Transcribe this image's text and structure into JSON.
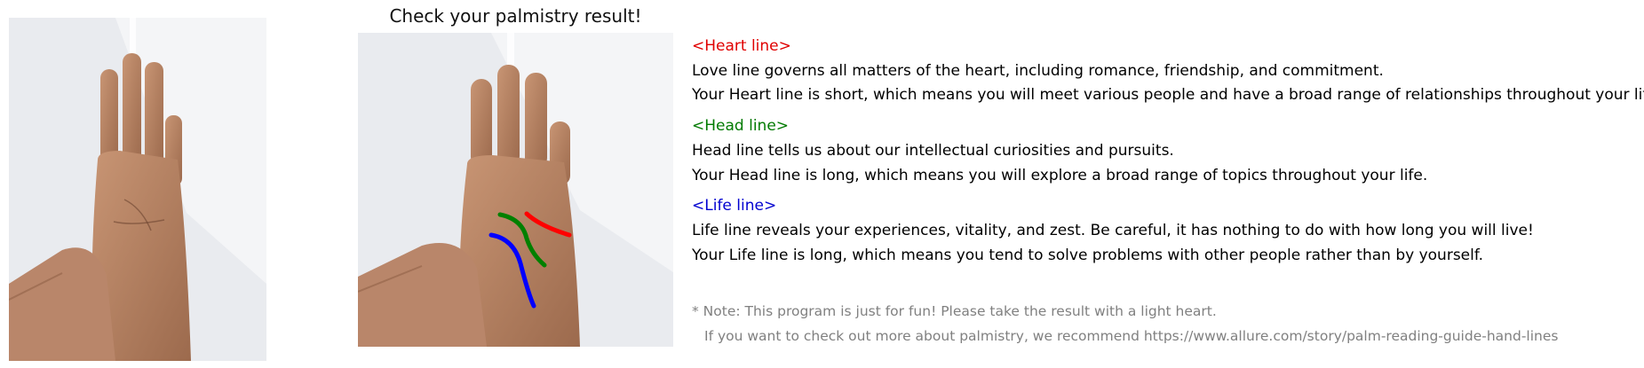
{
  "title": "Check your palmistry result!",
  "colors": {
    "heart": "#e00000",
    "head": "#007a00",
    "life": "#0000d0",
    "note": "#808080"
  },
  "sections": [
    {
      "heading": "<Heart line>",
      "description": "Love line governs all matters of the heart, including romance, friendship, and commitment.",
      "result": "Your Heart line is short, which means you will meet various people and have a broad range of relationships throughout your life."
    },
    {
      "heading": "<Head line>",
      "description": "Head line tells us about our intellectual curiosities and pursuits.",
      "result": "Your Head line is long, which means you will explore a broad range of topics throughout your life."
    },
    {
      "heading": "<Life line>",
      "description": "Life line reveals your experiences, vitality, and zest. Be careful, it has nothing to do with how long you will live!",
      "result": "Your Life line is long, which means you tend to solve problems with other people rather than by yourself."
    }
  ],
  "note": {
    "line1": "* Note: This program is just for fun! Please take the result with a light heart.",
    "line2": "If you want to check out more about palmistry, we recommend https://www.allure.com/story/palm-reading-guide-hand-lines"
  }
}
